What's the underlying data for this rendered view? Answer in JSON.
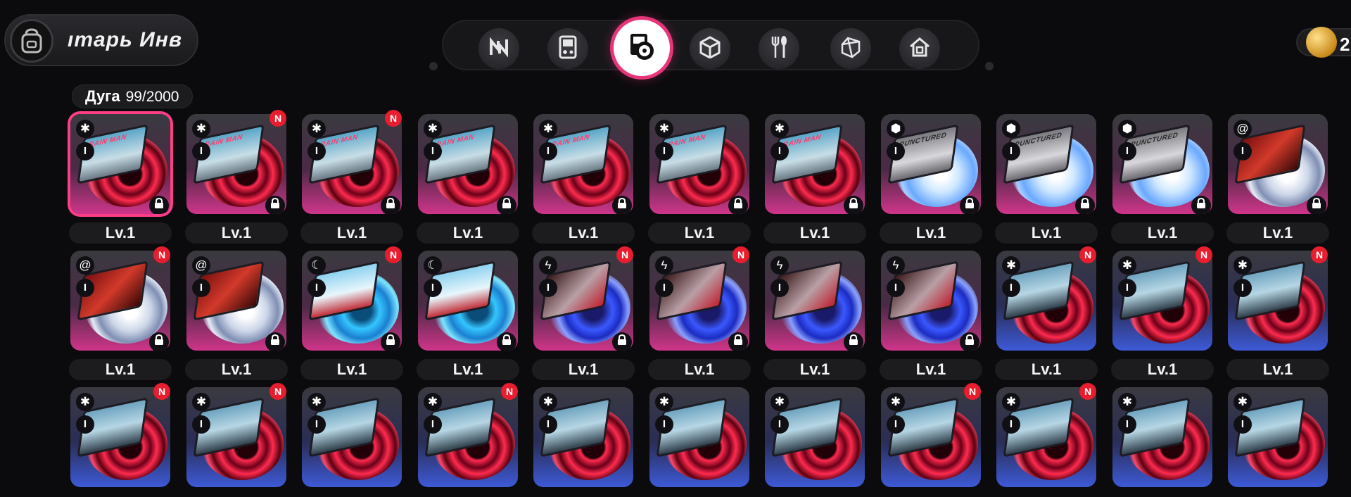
{
  "header": {
    "inventory_icon": "backpack-icon",
    "inventory_title": "ıтарь  Инв",
    "tabs": [
      {
        "name": "tab-n-logo",
        "icon": "n-logo-icon",
        "active": false
      },
      {
        "name": "tab-gameboy",
        "icon": "gameboy-icon",
        "active": false
      },
      {
        "name": "tab-disc",
        "icon": "disc-drive-icon",
        "active": true
      },
      {
        "name": "tab-box",
        "icon": "cube-icon",
        "active": false
      },
      {
        "name": "tab-food",
        "icon": "fork-spoon-icon",
        "active": false
      },
      {
        "name": "tab-gem",
        "icon": "gem-icon",
        "active": false
      },
      {
        "name": "tab-home",
        "icon": "house-icon",
        "active": false
      }
    ],
    "currency_icon": "coin-icon",
    "currency_value": "2"
  },
  "capacity": {
    "label": "Дуга",
    "count": "99/2000"
  },
  "colors": {
    "accent": "#e8357a",
    "new_badge": "#e81e2e",
    "rarity_s": "#d0358a",
    "rarity_a": "#3d5ad8"
  },
  "grid": {
    "rows": [
      [
        {
          "attr": "gear",
          "tier": "I",
          "disc": "red",
          "cover": "rain",
          "cover_text": "RAIN MAN",
          "rarity": "s",
          "new": false,
          "locked": true,
          "level": "Lv.1",
          "selected": true
        },
        {
          "attr": "gear",
          "tier": "I",
          "disc": "red",
          "cover": "rain",
          "cover_text": "RAIN MAN",
          "rarity": "s",
          "new": true,
          "locked": true,
          "level": "Lv.1"
        },
        {
          "attr": "gear",
          "tier": "I",
          "disc": "red",
          "cover": "rain",
          "cover_text": "RAIN MAN",
          "rarity": "s",
          "new": true,
          "locked": true,
          "level": "Lv.1"
        },
        {
          "attr": "gear",
          "tier": "I",
          "disc": "red",
          "cover": "rain",
          "cover_text": "RAIN MAN",
          "rarity": "s",
          "new": false,
          "locked": true,
          "level": "Lv.1"
        },
        {
          "attr": "gear",
          "tier": "I",
          "disc": "red",
          "cover": "rain",
          "cover_text": "RAIN MAN",
          "rarity": "s",
          "new": false,
          "locked": true,
          "level": "Lv.1"
        },
        {
          "attr": "gear",
          "tier": "I",
          "disc": "red",
          "cover": "rain",
          "cover_text": "RAIN MAN",
          "rarity": "s",
          "new": false,
          "locked": true,
          "level": "Lv.1"
        },
        {
          "attr": "gear",
          "tier": "I",
          "disc": "red",
          "cover": "rain",
          "cover_text": "RAIN MAN",
          "rarity": "s",
          "new": false,
          "locked": true,
          "level": "Lv.1"
        },
        {
          "attr": "cube",
          "tier": "I",
          "disc": "ice",
          "cover": "grey",
          "cover_text": "PUNCTURED",
          "rarity": "s",
          "new": false,
          "locked": true,
          "level": "Lv.1"
        },
        {
          "attr": "cube",
          "tier": "I",
          "disc": "ice",
          "cover": "grey",
          "cover_text": "PUNCTURED",
          "rarity": "s",
          "new": false,
          "locked": true,
          "level": "Lv.1"
        },
        {
          "attr": "cube",
          "tier": "I",
          "disc": "ice",
          "cover": "grey",
          "cover_text": "PUNCTURED",
          "rarity": "s",
          "new": false,
          "locked": true,
          "level": "Lv.1"
        },
        {
          "attr": "swirl",
          "tier": "I",
          "disc": "wind",
          "cover": "red",
          "cover_text": "",
          "rarity": "s",
          "new": false,
          "locked": true,
          "level": "Lv.1"
        }
      ],
      [
        {
          "attr": "swirl",
          "tier": "I",
          "disc": "wind",
          "cover": "red",
          "cover_text": "",
          "rarity": "s",
          "new": true,
          "locked": true,
          "level": "Lv.1"
        },
        {
          "attr": "swirl",
          "tier": "I",
          "disc": "wind",
          "cover": "red",
          "cover_text": "",
          "rarity": "s",
          "new": false,
          "locked": true,
          "level": "Lv.1"
        },
        {
          "attr": "moon",
          "tier": "I",
          "disc": "water",
          "cover": "shark",
          "cover_text": "",
          "rarity": "s",
          "new": true,
          "locked": true,
          "level": "Lv.1"
        },
        {
          "attr": "moon",
          "tier": "I",
          "disc": "water",
          "cover": "shark",
          "cover_text": "",
          "rarity": "s",
          "new": false,
          "locked": true,
          "level": "Lv.1"
        },
        {
          "attr": "bolt",
          "tier": "I",
          "disc": "elec",
          "cover": "storm",
          "cover_text": "",
          "rarity": "s",
          "new": true,
          "locked": true,
          "level": "Lv.1"
        },
        {
          "attr": "bolt",
          "tier": "I",
          "disc": "elec",
          "cover": "storm",
          "cover_text": "",
          "rarity": "s",
          "new": true,
          "locked": true,
          "level": "Lv.1"
        },
        {
          "attr": "bolt",
          "tier": "I",
          "disc": "elec",
          "cover": "storm",
          "cover_text": "",
          "rarity": "s",
          "new": false,
          "locked": true,
          "level": "Lv.1"
        },
        {
          "attr": "bolt",
          "tier": "I",
          "disc": "elec",
          "cover": "storm",
          "cover_text": "",
          "rarity": "s",
          "new": false,
          "locked": true,
          "level": "Lv.1"
        },
        {
          "attr": "gear",
          "tier": "I",
          "disc": "red",
          "cover": "robot",
          "cover_text": "",
          "rarity": "a",
          "new": true,
          "locked": false,
          "level": "Lv.1"
        },
        {
          "attr": "gear",
          "tier": "I",
          "disc": "red",
          "cover": "robot",
          "cover_text": "",
          "rarity": "a",
          "new": true,
          "locked": false,
          "level": "Lv.1"
        },
        {
          "attr": "gear",
          "tier": "I",
          "disc": "red",
          "cover": "robot",
          "cover_text": "",
          "rarity": "a",
          "new": true,
          "locked": false,
          "level": "Lv.1"
        }
      ],
      [
        {
          "attr": "gear",
          "tier": "I",
          "disc": "red",
          "cover": "robot",
          "cover_text": "",
          "rarity": "a",
          "new": true,
          "locked": false,
          "level": ""
        },
        {
          "attr": "gear",
          "tier": "I",
          "disc": "red",
          "cover": "robot",
          "cover_text": "",
          "rarity": "a",
          "new": true,
          "locked": false,
          "level": ""
        },
        {
          "attr": "gear",
          "tier": "I",
          "disc": "red",
          "cover": "robot",
          "cover_text": "",
          "rarity": "a",
          "new": false,
          "locked": false,
          "level": ""
        },
        {
          "attr": "gear",
          "tier": "I",
          "disc": "red",
          "cover": "robot",
          "cover_text": "",
          "rarity": "a",
          "new": true,
          "locked": false,
          "level": ""
        },
        {
          "attr": "gear",
          "tier": "I",
          "disc": "red",
          "cover": "robot",
          "cover_text": "",
          "rarity": "a",
          "new": false,
          "locked": false,
          "level": ""
        },
        {
          "attr": "gear",
          "tier": "I",
          "disc": "red",
          "cover": "robot",
          "cover_text": "",
          "rarity": "a",
          "new": false,
          "locked": false,
          "level": ""
        },
        {
          "attr": "gear",
          "tier": "I",
          "disc": "red",
          "cover": "robot",
          "cover_text": "",
          "rarity": "a",
          "new": false,
          "locked": false,
          "level": ""
        },
        {
          "attr": "gear",
          "tier": "I",
          "disc": "red",
          "cover": "robot",
          "cover_text": "",
          "rarity": "a",
          "new": true,
          "locked": false,
          "level": ""
        },
        {
          "attr": "gear",
          "tier": "I",
          "disc": "red",
          "cover": "robot",
          "cover_text": "",
          "rarity": "a",
          "new": true,
          "locked": false,
          "level": ""
        },
        {
          "attr": "gear",
          "tier": "I",
          "disc": "red",
          "cover": "robot",
          "cover_text": "",
          "rarity": "a",
          "new": false,
          "locked": false,
          "level": ""
        },
        {
          "attr": "gear",
          "tier": "I",
          "disc": "red",
          "cover": "robot",
          "cover_text": "",
          "rarity": "a",
          "new": false,
          "locked": false,
          "level": ""
        }
      ]
    ],
    "new_label": "N"
  }
}
